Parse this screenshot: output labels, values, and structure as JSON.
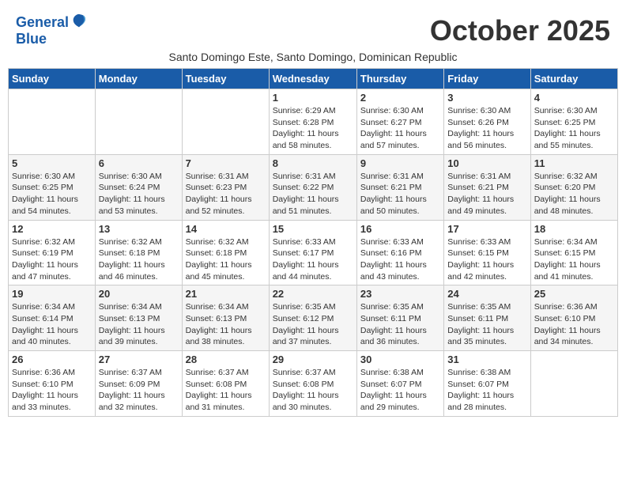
{
  "logo": {
    "line1": "General",
    "line2": "Blue"
  },
  "title": "October 2025",
  "subtitle": "Santo Domingo Este, Santo Domingo, Dominican Republic",
  "weekdays": [
    "Sunday",
    "Monday",
    "Tuesday",
    "Wednesday",
    "Thursday",
    "Friday",
    "Saturday"
  ],
  "weeks": [
    [
      {
        "day": "",
        "info": ""
      },
      {
        "day": "",
        "info": ""
      },
      {
        "day": "",
        "info": ""
      },
      {
        "day": "1",
        "info": "Sunrise: 6:29 AM\nSunset: 6:28 PM\nDaylight: 11 hours\nand 58 minutes."
      },
      {
        "day": "2",
        "info": "Sunrise: 6:30 AM\nSunset: 6:27 PM\nDaylight: 11 hours\nand 57 minutes."
      },
      {
        "day": "3",
        "info": "Sunrise: 6:30 AM\nSunset: 6:26 PM\nDaylight: 11 hours\nand 56 minutes."
      },
      {
        "day": "4",
        "info": "Sunrise: 6:30 AM\nSunset: 6:25 PM\nDaylight: 11 hours\nand 55 minutes."
      }
    ],
    [
      {
        "day": "5",
        "info": "Sunrise: 6:30 AM\nSunset: 6:25 PM\nDaylight: 11 hours\nand 54 minutes."
      },
      {
        "day": "6",
        "info": "Sunrise: 6:30 AM\nSunset: 6:24 PM\nDaylight: 11 hours\nand 53 minutes."
      },
      {
        "day": "7",
        "info": "Sunrise: 6:31 AM\nSunset: 6:23 PM\nDaylight: 11 hours\nand 52 minutes."
      },
      {
        "day": "8",
        "info": "Sunrise: 6:31 AM\nSunset: 6:22 PM\nDaylight: 11 hours\nand 51 minutes."
      },
      {
        "day": "9",
        "info": "Sunrise: 6:31 AM\nSunset: 6:21 PM\nDaylight: 11 hours\nand 50 minutes."
      },
      {
        "day": "10",
        "info": "Sunrise: 6:31 AM\nSunset: 6:21 PM\nDaylight: 11 hours\nand 49 minutes."
      },
      {
        "day": "11",
        "info": "Sunrise: 6:32 AM\nSunset: 6:20 PM\nDaylight: 11 hours\nand 48 minutes."
      }
    ],
    [
      {
        "day": "12",
        "info": "Sunrise: 6:32 AM\nSunset: 6:19 PM\nDaylight: 11 hours\nand 47 minutes."
      },
      {
        "day": "13",
        "info": "Sunrise: 6:32 AM\nSunset: 6:18 PM\nDaylight: 11 hours\nand 46 minutes."
      },
      {
        "day": "14",
        "info": "Sunrise: 6:32 AM\nSunset: 6:18 PM\nDaylight: 11 hours\nand 45 minutes."
      },
      {
        "day": "15",
        "info": "Sunrise: 6:33 AM\nSunset: 6:17 PM\nDaylight: 11 hours\nand 44 minutes."
      },
      {
        "day": "16",
        "info": "Sunrise: 6:33 AM\nSunset: 6:16 PM\nDaylight: 11 hours\nand 43 minutes."
      },
      {
        "day": "17",
        "info": "Sunrise: 6:33 AM\nSunset: 6:15 PM\nDaylight: 11 hours\nand 42 minutes."
      },
      {
        "day": "18",
        "info": "Sunrise: 6:34 AM\nSunset: 6:15 PM\nDaylight: 11 hours\nand 41 minutes."
      }
    ],
    [
      {
        "day": "19",
        "info": "Sunrise: 6:34 AM\nSunset: 6:14 PM\nDaylight: 11 hours\nand 40 minutes."
      },
      {
        "day": "20",
        "info": "Sunrise: 6:34 AM\nSunset: 6:13 PM\nDaylight: 11 hours\nand 39 minutes."
      },
      {
        "day": "21",
        "info": "Sunrise: 6:34 AM\nSunset: 6:13 PM\nDaylight: 11 hours\nand 38 minutes."
      },
      {
        "day": "22",
        "info": "Sunrise: 6:35 AM\nSunset: 6:12 PM\nDaylight: 11 hours\nand 37 minutes."
      },
      {
        "day": "23",
        "info": "Sunrise: 6:35 AM\nSunset: 6:11 PM\nDaylight: 11 hours\nand 36 minutes."
      },
      {
        "day": "24",
        "info": "Sunrise: 6:35 AM\nSunset: 6:11 PM\nDaylight: 11 hours\nand 35 minutes."
      },
      {
        "day": "25",
        "info": "Sunrise: 6:36 AM\nSunset: 6:10 PM\nDaylight: 11 hours\nand 34 minutes."
      }
    ],
    [
      {
        "day": "26",
        "info": "Sunrise: 6:36 AM\nSunset: 6:10 PM\nDaylight: 11 hours\nand 33 minutes."
      },
      {
        "day": "27",
        "info": "Sunrise: 6:37 AM\nSunset: 6:09 PM\nDaylight: 11 hours\nand 32 minutes."
      },
      {
        "day": "28",
        "info": "Sunrise: 6:37 AM\nSunset: 6:08 PM\nDaylight: 11 hours\nand 31 minutes."
      },
      {
        "day": "29",
        "info": "Sunrise: 6:37 AM\nSunset: 6:08 PM\nDaylight: 11 hours\nand 30 minutes."
      },
      {
        "day": "30",
        "info": "Sunrise: 6:38 AM\nSunset: 6:07 PM\nDaylight: 11 hours\nand 29 minutes."
      },
      {
        "day": "31",
        "info": "Sunrise: 6:38 AM\nSunset: 6:07 PM\nDaylight: 11 hours\nand 28 minutes."
      },
      {
        "day": "",
        "info": ""
      }
    ]
  ]
}
